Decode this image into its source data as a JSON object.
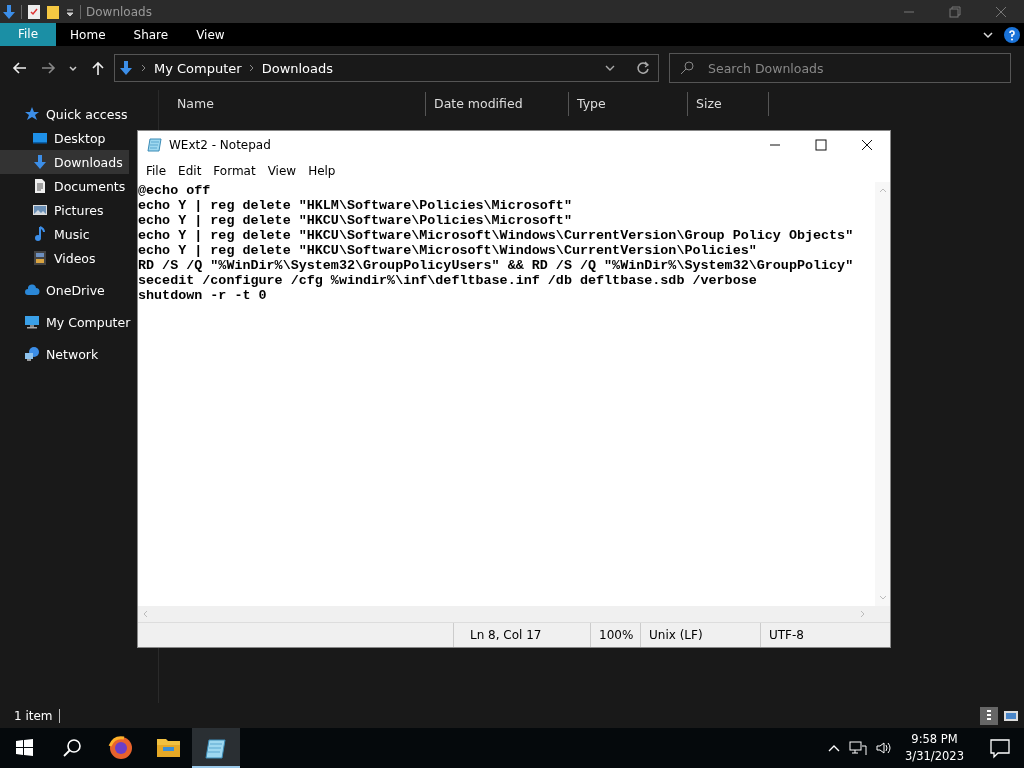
{
  "explorer": {
    "title": "Downloads",
    "ribbon": {
      "file_tab": "File",
      "tabs": [
        "Home",
        "Share",
        "View"
      ]
    },
    "address": {
      "path": [
        "My Computer",
        "Downloads"
      ]
    },
    "search": {
      "placeholder": "Search Downloads"
    },
    "nav_pane": [
      {
        "label": "Quick access",
        "kind": "star",
        "selected": false,
        "children": [
          {
            "label": "Desktop",
            "kind": "desktop",
            "selected": false
          },
          {
            "label": "Downloads",
            "kind": "download",
            "selected": true
          },
          {
            "label": "Documents",
            "kind": "document",
            "selected": false
          },
          {
            "label": "Pictures",
            "kind": "pictures",
            "selected": false
          },
          {
            "label": "Music",
            "kind": "music",
            "selected": false
          },
          {
            "label": "Videos",
            "kind": "videos",
            "selected": false
          }
        ]
      },
      {
        "label": "OneDrive",
        "kind": "cloud",
        "selected": false
      },
      {
        "label": "My Computer",
        "kind": "computer",
        "selected": false
      },
      {
        "label": "Network",
        "kind": "network",
        "selected": false
      }
    ],
    "columns": [
      "Name",
      "Date modified",
      "Type",
      "Size"
    ],
    "status_bar": "1 item"
  },
  "notepad": {
    "title": "WExt2 - Notepad",
    "menu": [
      "File",
      "Edit",
      "Format",
      "View",
      "Help"
    ],
    "lines": [
      "@echo off",
      "echo Y | reg delete \"HKLM\\Software\\Policies\\Microsoft\"",
      "echo Y | reg delete \"HKCU\\Software\\Policies\\Microsoft\"",
      "echo Y | reg delete \"HKCU\\Software\\Microsoft\\Windows\\CurrentVersion\\Group Policy Objects\"",
      "echo Y | reg delete \"HKCU\\Software\\Microsoft\\Windows\\CurrentVersion\\Policies\"",
      "RD /S /Q \"%WinDir%\\System32\\GroupPolicyUsers\" && RD /S /Q \"%WinDir%\\System32\\GroupPolicy\"",
      "secedit /configure /cfg %windir%\\inf\\defltbase.inf /db defltbase.sdb /verbose",
      "shutdown -r -t 0"
    ],
    "status_bar": [
      "Ln 8, Col 17",
      "100%",
      "Unix (LF)",
      "UTF-8"
    ]
  },
  "taskbar": {
    "apps": [
      {
        "kind": "browser",
        "active": false
      },
      {
        "kind": "folder",
        "active": false
      },
      {
        "kind": "notepad",
        "active": true
      }
    ],
    "time": "9:58 PM",
    "date": "3/31/2023"
  }
}
